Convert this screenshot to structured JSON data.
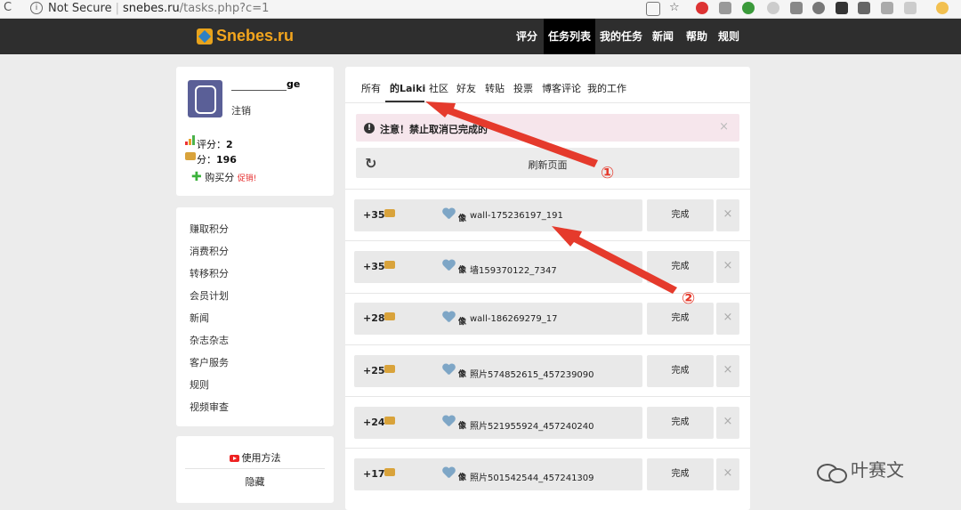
{
  "browser": {
    "security": "Not Secure",
    "host": "snebes.ru",
    "path": "/tasks.php?c=1"
  },
  "brand": {
    "name": "Snebes.ru"
  },
  "nav": [
    {
      "label": "评分"
    },
    {
      "label": "任务列表"
    },
    {
      "label": "我的任务"
    },
    {
      "label": "新闻"
    },
    {
      "label": "帮助"
    },
    {
      "label": "规则"
    }
  ],
  "user": {
    "name_suffix": "ge",
    "logout": "注销",
    "rating_label": "评分：",
    "rating_value": "2",
    "points_label": "分：",
    "points_value": "196",
    "buy_label": "购买分",
    "promo": "促销!"
  },
  "sidebar_menu": [
    {
      "label": "赚取积分"
    },
    {
      "label": "消费积分"
    },
    {
      "label": "转移积分"
    },
    {
      "label": "会员计划"
    },
    {
      "label": "新闻"
    },
    {
      "label": "杂志杂志"
    },
    {
      "label": "客户服务"
    },
    {
      "label": "规则"
    },
    {
      "label": "视频审查"
    }
  ],
  "help_box": {
    "usage": "使用方法",
    "hide": "隐藏"
  },
  "tabs": [
    {
      "label": "所有"
    },
    {
      "label": "的Laiki"
    },
    {
      "label": "社区"
    },
    {
      "label": "好友"
    },
    {
      "label": "转贴"
    },
    {
      "label": "投票"
    },
    {
      "label": "博客评论"
    },
    {
      "label": "我的工作"
    }
  ],
  "notice": {
    "text": "注意！禁止取消已完成的",
    "close": "×"
  },
  "refresh": {
    "label": "刷新页面"
  },
  "tasks": [
    {
      "points": "+35",
      "like": "像",
      "name": "wall-175236197_191",
      "done": "完成",
      "dismiss": "×"
    },
    {
      "points": "+35",
      "like": "像",
      "name": "墙159370122_7347",
      "done": "完成",
      "dismiss": "×"
    },
    {
      "points": "+28",
      "like": "像",
      "name": "wall-186269279_17",
      "done": "完成",
      "dismiss": "×"
    },
    {
      "points": "+25",
      "like": "像",
      "name": "照片574852615_457239090",
      "done": "完成",
      "dismiss": "×"
    },
    {
      "points": "+24",
      "like": "像",
      "name": "照片521955924_457240240",
      "done": "完成",
      "dismiss": "×"
    },
    {
      "points": "+17",
      "like": "像",
      "name": "照片501542544_457241309",
      "done": "完成",
      "dismiss": "×"
    }
  ],
  "annotations": {
    "marker1": "①",
    "marker2": "②"
  },
  "watermark": {
    "text": "叶赛文"
  },
  "colors": {
    "nav_bg": "#2e2e2e",
    "brand": "#f3a51d",
    "arrow": "#e53a2c",
    "notice_bg": "#f6e6ec"
  }
}
